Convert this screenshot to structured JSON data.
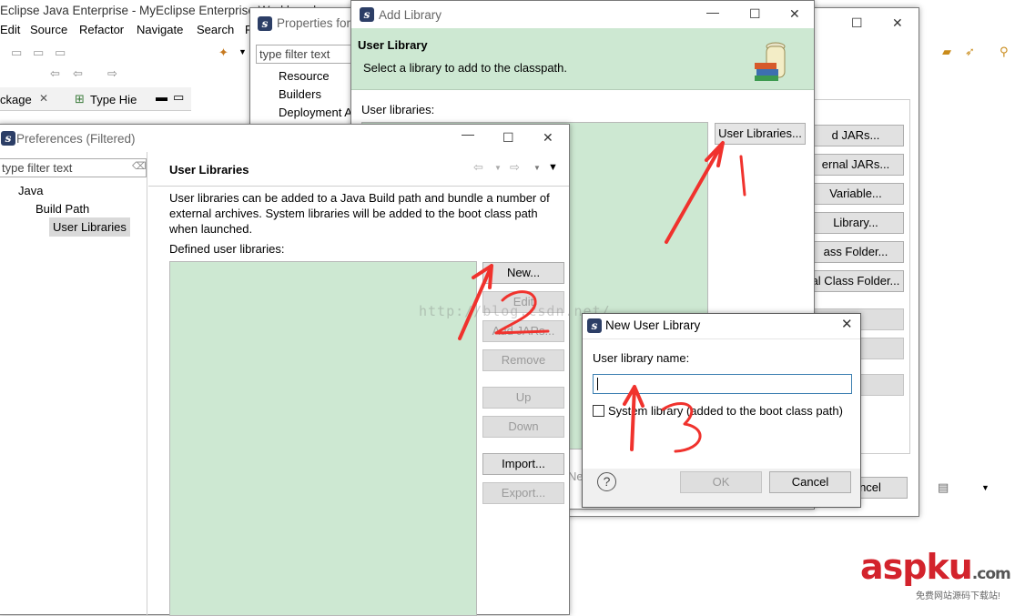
{
  "workbench": {
    "title": "Eclipse Java Enterprise - MyEclipse Enterprise Workbench",
    "menu": [
      "Edit",
      "Source",
      "Refactor",
      "Navigate",
      "Search",
      "P"
    ],
    "tabs": {
      "package": "ckage",
      "type_hierarchy": "Type Hie"
    }
  },
  "properties_window": {
    "title": "Properties for",
    "filter_placeholder": "type filter text",
    "tree": [
      "Resource",
      "Builders",
      "Deployment A"
    ],
    "right_buttons": [
      "d JARs...",
      "ernal JARs...",
      "Variable...",
      "Library...",
      "ass Folder...",
      "al Class Folder..."
    ],
    "cancel": "ncel"
  },
  "add_library": {
    "title": "Add Library",
    "header_title": "User Library",
    "header_desc": "Select a library to add to the classpath.",
    "list_label": "User libraries:",
    "user_libraries_button": "User Libraries...",
    "bottom_partial": "Ne"
  },
  "preferences": {
    "title": "Preferences (Filtered)",
    "filter_placeholder": "type filter text",
    "tree": {
      "java": "Java",
      "build_path": "Build Path",
      "user_libraries": "User Libraries"
    },
    "page_title": "User Libraries",
    "description": [
      "User libraries can be added to a Java Build path and bundle a number of",
      "external archives. System libraries will be added to the boot class path",
      "when launched."
    ],
    "defined_label": "Defined user libraries:",
    "buttons": {
      "new": "New...",
      "edit": "Edit",
      "add_jars": "Add JARs...",
      "remove": "Remove",
      "up": "Up",
      "down": "Down",
      "import": "Import...",
      "export": "Export..."
    }
  },
  "new_user_library": {
    "title": "New User Library",
    "name_label": "User library name:",
    "name_value": "",
    "system_checkbox": "System library (added to the boot class path)",
    "system_checked": false,
    "ok": "OK",
    "cancel": "Cancel"
  },
  "annotations": {
    "one": "1",
    "two": "2",
    "three": "3"
  },
  "watermark": {
    "url": "http://blog.csdn.net/",
    "brand": "aspku",
    "brand_suffix": ".com",
    "tagline": "免费网站源码下载站!"
  },
  "colors": {
    "accent_green": "#cde8d2",
    "arrow_red": "#f0322d",
    "brand_red": "#d3232c"
  }
}
